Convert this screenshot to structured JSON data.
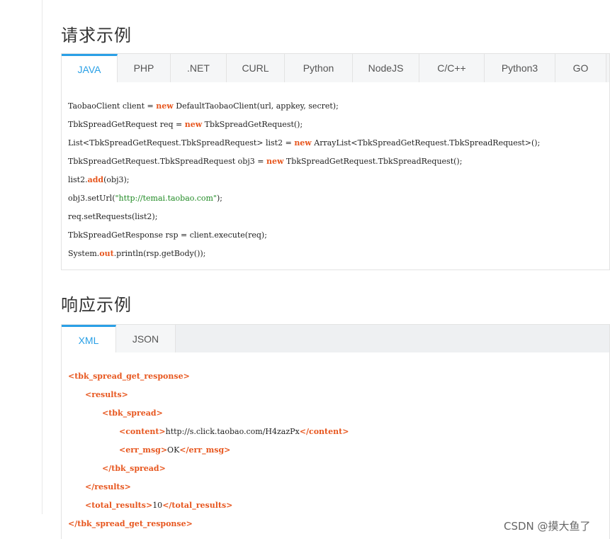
{
  "request_section": {
    "title": "请求示例",
    "tabs": [
      "JAVA",
      "PHP",
      ".NET",
      "CURL",
      "Python",
      "NodeJS",
      "C/C++",
      "Python3",
      "GO"
    ],
    "active_tab": "JAVA",
    "code_lines": [
      "TaobaoClient client = new DefaultTaobaoClient(url, appkey, secret);",
      "TbkSpreadGetRequest req = new TbkSpreadGetRequest();",
      "List<TbkSpreadGetRequest.TbkSpreadRequest> list2 = new ArrayList<TbkSpreadGetRequest.TbkSpreadRequest>();",
      "TbkSpreadGetRequest.TbkSpreadRequest obj3 = new TbkSpreadGetRequest.TbkSpreadRequest();",
      "list2.add(obj3);",
      "obj3.setUrl(\"http://temai.taobao.com\");",
      "req.setRequests(list2);",
      "TbkSpreadGetResponse rsp = client.execute(req);",
      "System.out.println(rsp.getBody());"
    ]
  },
  "response_section": {
    "title": "响应示例",
    "tabs": [
      "XML",
      "JSON"
    ],
    "active_tab": "XML",
    "xml_lines": [
      {
        "open": "<tbk_spread_get_response>",
        "text": "",
        "close": ""
      },
      {
        "open": "<results>",
        "text": "",
        "close": ""
      },
      {
        "open": "<tbk_spread>",
        "text": "",
        "close": ""
      },
      {
        "open": "<content>",
        "text": "http://s.click.taobao.com/H4zazPx",
        "close": "</content>"
      },
      {
        "open": "<err_msg>",
        "text": "OK",
        "close": "</err_msg>"
      },
      {
        "open": "</tbk_spread>",
        "text": "",
        "close": ""
      },
      {
        "open": "</results>",
        "text": "",
        "close": ""
      },
      {
        "open": "<total_results>",
        "text": "10",
        "close": "</total_results>"
      },
      {
        "open": "</tbk_spread_get_response>",
        "text": "",
        "close": ""
      }
    ]
  },
  "watermark": "CSDN @摸大鱼了",
  "colors": {
    "accent": "#2aa0e6",
    "keyword": "#e7561e",
    "string": "#1f8a23"
  }
}
